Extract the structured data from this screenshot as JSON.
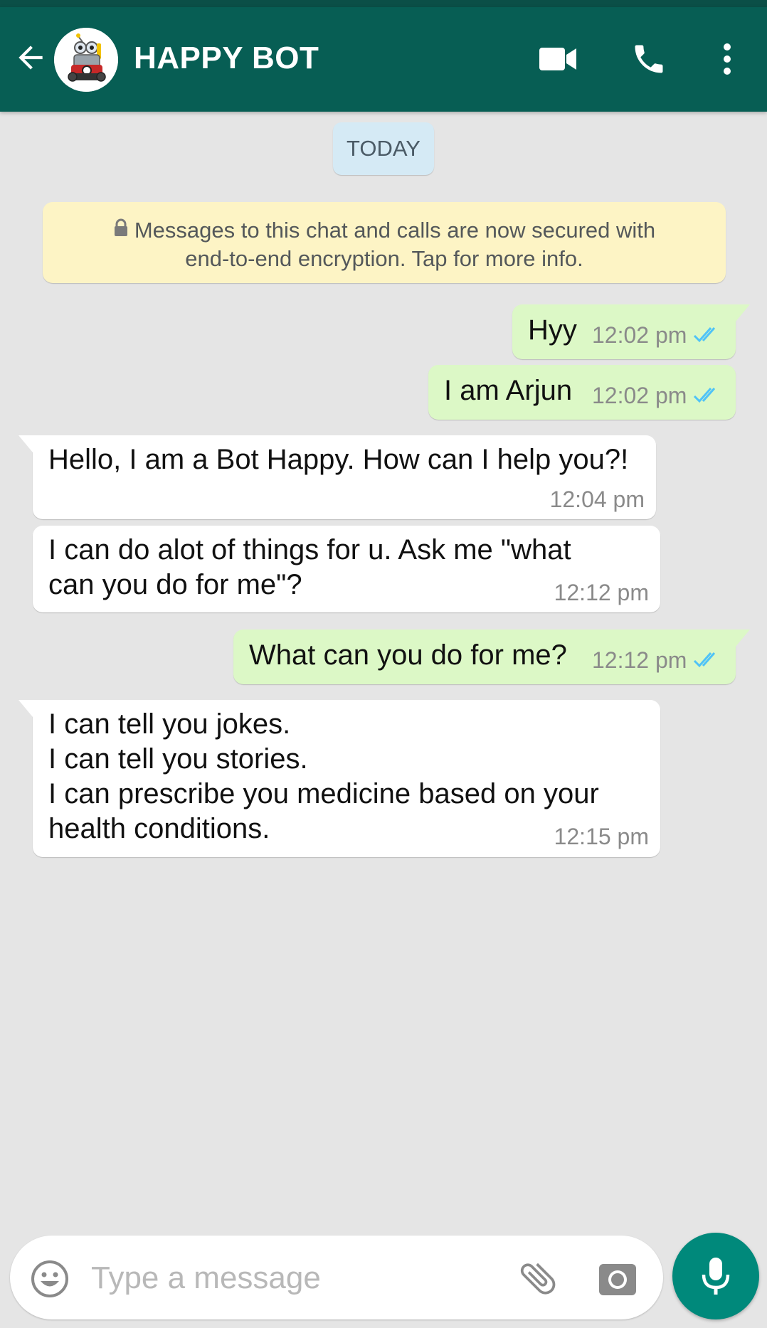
{
  "header": {
    "contact_name": "HAPPY BOT"
  },
  "date_chip": "TODAY",
  "encryption_notice": {
    "line1": "Messages to this chat and calls are now secured with",
    "line2": "end-to-end encryption. Tap for more info."
  },
  "messages": [
    {
      "direction": "outgoing",
      "text": "Hyy",
      "time": "12:02 pm",
      "status": "read"
    },
    {
      "direction": "outgoing",
      "text": "I am Arjun",
      "time": "12:02 pm",
      "status": "read"
    },
    {
      "direction": "incoming",
      "text": "Hello, I am a Bot Happy. How can I help you?!",
      "time": "12:04 pm"
    },
    {
      "direction": "incoming",
      "text": "I can do alot of things for u. Ask me \"what\ncan you do for me\"?",
      "time": "12:12 pm"
    },
    {
      "direction": "outgoing",
      "text": "What can you do for me?",
      "time": "12:12 pm",
      "status": "read"
    },
    {
      "direction": "incoming",
      "text": "I can tell you jokes.\nI can tell you stories.\nI can prescribe you medicine based on your\nhealth conditions.",
      "time": "12:15 pm"
    }
  ],
  "composer": {
    "placeholder": "Type a message"
  },
  "colors": {
    "header": "#075e54",
    "outgoing_bubble": "#dcf8c6",
    "incoming_bubble": "#ffffff",
    "read_ticks": "#4fc3f7",
    "mic_button": "#00897b"
  },
  "icons": {
    "back": "arrow-left-icon",
    "video": "video-camera-icon",
    "call": "phone-icon",
    "menu": "more-vertical-icon",
    "lock": "lock-icon",
    "emoji": "emoji-icon",
    "attach": "paperclip-icon",
    "camera": "camera-icon",
    "mic": "microphone-icon"
  }
}
